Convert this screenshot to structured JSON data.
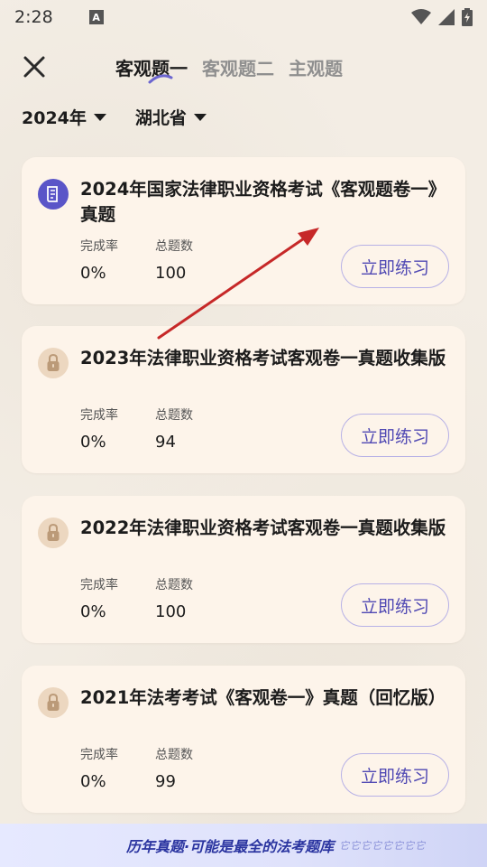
{
  "status": {
    "time": "2:28",
    "a_badge": "A"
  },
  "tabs": [
    {
      "label": "客观题一",
      "active": true
    },
    {
      "label": "客观题二",
      "active": false
    },
    {
      "label": "主观题",
      "active": false
    }
  ],
  "filters": {
    "year": "2024年",
    "province": "湖北省"
  },
  "cards": [
    {
      "title": "2024年国家法律职业资格考试《客观题卷一》真题",
      "completion_label": "完成率",
      "completion": "0%",
      "total_label": "总题数",
      "total": "100",
      "button": "立即练习",
      "icon": "document-icon"
    },
    {
      "title": "2023年法律职业资格考试客观卷一真题收集版",
      "completion_label": "完成率",
      "completion": "0%",
      "total_label": "总题数",
      "total": "94",
      "button": "立即练习",
      "icon": "lock-icon"
    },
    {
      "title": "2022年法律职业资格考试客观卷一真题收集版",
      "completion_label": "完成率",
      "completion": "0%",
      "total_label": "总题数",
      "total": "100",
      "button": "立即练习",
      "icon": "lock-icon"
    },
    {
      "title": "2021年法考考试《客观卷一》真题（回忆版）",
      "completion_label": "完成率",
      "completion": "0%",
      "total_label": "总题数",
      "total": "99",
      "button": "立即练习",
      "icon": "lock-icon"
    }
  ],
  "banner": {
    "text": "历年真题·可能是最全的法考题库",
    "ghost": "它它它它它它它它"
  },
  "colors": {
    "accent": "#4f48b3",
    "card_bg": "#fdf4ea",
    "page_bg": "#f3ede4",
    "arrow": "#c62828"
  }
}
